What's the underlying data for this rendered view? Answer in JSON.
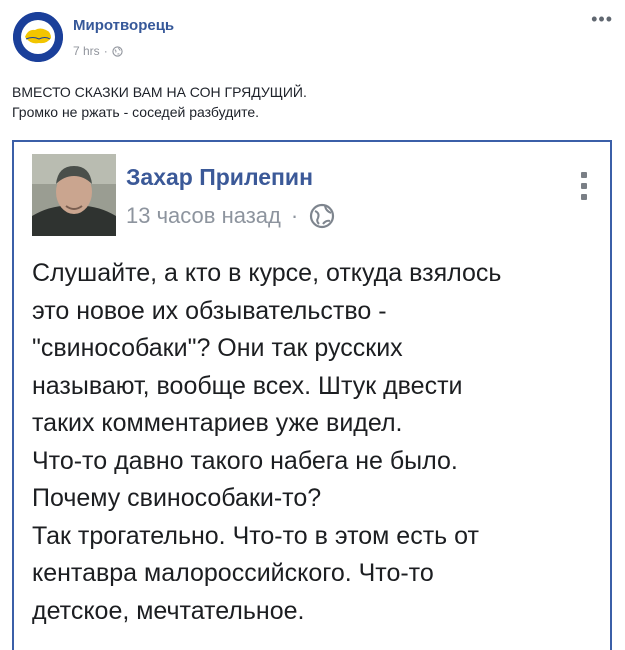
{
  "post": {
    "page_name": "Миротворець",
    "time": "7 hrs",
    "separator": "·",
    "more": "•••",
    "caption_lines": [
      "ВМЕСТО СКАЗКИ ВАМ НА СОН ГРЯДУЩИЙ.",
      "Громко не ржать - соседей разбудите."
    ],
    "avatar_logo_text": "МИРОТВОРЕЦЬ · PRO BONO PUBLICO"
  },
  "shared": {
    "author": "Захар Прилепин",
    "time": "13 часов назад",
    "separator": "·",
    "body_lines": [
      "Слушайте, а кто в курсе, откуда взялось",
      "это новое их обзывательство -",
      "\"свинособаки\"? Они так русских",
      "называют, вообще всех. Штук двести",
      "таких комментариев уже видел.",
      "Что-то давно такого набега не было.",
      "Почему свинособаки-то?",
      "Так трогательно. Что-то в этом есть от",
      "кентавра малороссийского. Что-то",
      "детское, мечтательное."
    ]
  },
  "colors": {
    "link_blue": "#365899",
    "card_border": "#3b5fa8",
    "meta_gray": "#90949c"
  }
}
